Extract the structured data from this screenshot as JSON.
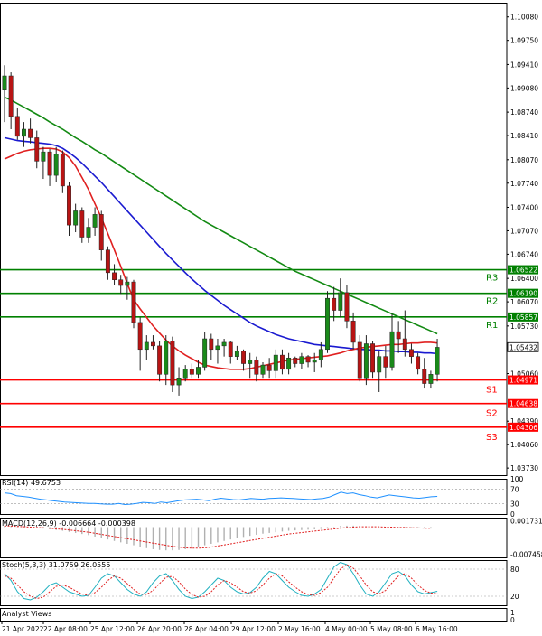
{
  "chart_data": [
    {
      "type": "candlestick",
      "panel": "main",
      "yaxis_ticks": [
        "1.10080",
        "1.09750",
        "1.09410",
        "1.09080",
        "1.08740",
        "1.08410",
        "1.08070",
        "1.07740",
        "1.07400",
        "1.07070",
        "1.06740",
        "1.06400",
        "1.06070",
        "1.05730",
        "1.05060",
        "1.04390",
        "1.04060",
        "1.03730"
      ],
      "ylim": [
        1.0363,
        1.1028
      ],
      "candles": [
        {
          "o": 1.0905,
          "h": 1.094,
          "l": 1.086,
          "c": 1.0925
        },
        {
          "o": 1.0925,
          "h": 1.093,
          "l": 1.085,
          "c": 1.0868
        },
        {
          "o": 1.0868,
          "h": 1.088,
          "l": 1.0835,
          "c": 1.084
        },
        {
          "o": 1.084,
          "h": 1.086,
          "l": 1.0825,
          "c": 1.085
        },
        {
          "o": 1.085,
          "h": 1.0865,
          "l": 1.083,
          "c": 1.0838
        },
        {
          "o": 1.0838,
          "h": 1.0848,
          "l": 1.0795,
          "c": 1.0805
        },
        {
          "o": 1.0805,
          "h": 1.0825,
          "l": 1.078,
          "c": 1.0818
        },
        {
          "o": 1.0818,
          "h": 1.0822,
          "l": 1.077,
          "c": 1.0785
        },
        {
          "o": 1.0785,
          "h": 1.0825,
          "l": 1.0775,
          "c": 1.0815
        },
        {
          "o": 1.0815,
          "h": 1.082,
          "l": 1.076,
          "c": 1.077
        },
        {
          "o": 1.077,
          "h": 1.0775,
          "l": 1.07,
          "c": 1.0715
        },
        {
          "o": 1.0715,
          "h": 1.0745,
          "l": 1.0705,
          "c": 1.0735
        },
        {
          "o": 1.0735,
          "h": 1.074,
          "l": 1.069,
          "c": 1.0698
        },
        {
          "o": 1.0698,
          "h": 1.0725,
          "l": 1.069,
          "c": 1.0712
        },
        {
          "o": 1.0712,
          "h": 1.074,
          "l": 1.07,
          "c": 1.073
        },
        {
          "o": 1.073,
          "h": 1.0735,
          "l": 1.0665,
          "c": 1.068
        },
        {
          "o": 1.068,
          "h": 1.0685,
          "l": 1.0638,
          "c": 1.0648
        },
        {
          "o": 1.0648,
          "h": 1.066,
          "l": 1.063,
          "c": 1.0638
        },
        {
          "o": 1.0638,
          "h": 1.0645,
          "l": 1.0618,
          "c": 1.063
        },
        {
          "o": 1.063,
          "h": 1.0642,
          "l": 1.061,
          "c": 1.0635
        },
        {
          "o": 1.0635,
          "h": 1.0638,
          "l": 1.057,
          "c": 1.0578
        },
        {
          "o": 1.0578,
          "h": 1.0585,
          "l": 1.051,
          "c": 1.054
        },
        {
          "o": 1.054,
          "h": 1.056,
          "l": 1.0525,
          "c": 1.055
        },
        {
          "o": 1.055,
          "h": 1.056,
          "l": 1.054,
          "c": 1.0545
        },
        {
          "o": 1.0545,
          "h": 1.0552,
          "l": 1.0495,
          "c": 1.0505
        },
        {
          "o": 1.0505,
          "h": 1.056,
          "l": 1.049,
          "c": 1.0552
        },
        {
          "o": 1.0552,
          "h": 1.0558,
          "l": 1.048,
          "c": 1.049
        },
        {
          "o": 1.049,
          "h": 1.0515,
          "l": 1.0475,
          "c": 1.05
        },
        {
          "o": 1.05,
          "h": 1.0518,
          "l": 1.0495,
          "c": 1.0512
        },
        {
          "o": 1.0512,
          "h": 1.052,
          "l": 1.05,
          "c": 1.0505
        },
        {
          "o": 1.0505,
          "h": 1.0525,
          "l": 1.05,
          "c": 1.0515
        },
        {
          "o": 1.0515,
          "h": 1.0565,
          "l": 1.051,
          "c": 1.0555
        },
        {
          "o": 1.0555,
          "h": 1.0562,
          "l": 1.0525,
          "c": 1.054
        },
        {
          "o": 1.054,
          "h": 1.0555,
          "l": 1.052,
          "c": 1.0545
        },
        {
          "o": 1.0545,
          "h": 1.0555,
          "l": 1.053,
          "c": 1.055
        },
        {
          "o": 1.055,
          "h": 1.0552,
          "l": 1.052,
          "c": 1.053
        },
        {
          "o": 1.053,
          "h": 1.0545,
          "l": 1.0525,
          "c": 1.0538
        },
        {
          "o": 1.0538,
          "h": 1.054,
          "l": 1.051,
          "c": 1.052
        },
        {
          "o": 1.052,
          "h": 1.0535,
          "l": 1.05,
          "c": 1.0525
        },
        {
          "o": 1.0525,
          "h": 1.053,
          "l": 1.0495,
          "c": 1.0505
        },
        {
          "o": 1.0505,
          "h": 1.0522,
          "l": 1.05,
          "c": 1.0518
        },
        {
          "o": 1.0518,
          "h": 1.0528,
          "l": 1.05,
          "c": 1.051
        },
        {
          "o": 1.051,
          "h": 1.054,
          "l": 1.05,
          "c": 1.0532
        },
        {
          "o": 1.0532,
          "h": 1.054,
          "l": 1.0505,
          "c": 1.0512
        },
        {
          "o": 1.0512,
          "h": 1.0535,
          "l": 1.0505,
          "c": 1.0528
        },
        {
          "o": 1.0528,
          "h": 1.053,
          "l": 1.0515,
          "c": 1.052
        },
        {
          "o": 1.052,
          "h": 1.0535,
          "l": 1.0512,
          "c": 1.053
        },
        {
          "o": 1.053,
          "h": 1.0532,
          "l": 1.0515,
          "c": 1.0522
        },
        {
          "o": 1.0522,
          "h": 1.0535,
          "l": 1.0508,
          "c": 1.0525
        },
        {
          "o": 1.0525,
          "h": 1.055,
          "l": 1.0515,
          "c": 1.054
        },
        {
          "o": 1.054,
          "h": 1.0622,
          "l": 1.0535,
          "c": 1.0612
        },
        {
          "o": 1.0612,
          "h": 1.0628,
          "l": 1.058,
          "c": 1.0595
        },
        {
          "o": 1.0595,
          "h": 1.064,
          "l": 1.0585,
          "c": 1.062
        },
        {
          "o": 1.062,
          "h": 1.063,
          "l": 1.057,
          "c": 1.058
        },
        {
          "o": 1.058,
          "h": 1.0592,
          "l": 1.054,
          "c": 1.055
        },
        {
          "o": 1.055,
          "h": 1.056,
          "l": 1.0495,
          "c": 1.05
        },
        {
          "o": 1.05,
          "h": 1.056,
          "l": 1.049,
          "c": 1.0548
        },
        {
          "o": 1.0548,
          "h": 1.0552,
          "l": 1.05,
          "c": 1.0508
        },
        {
          "o": 1.0508,
          "h": 1.0538,
          "l": 1.048,
          "c": 1.053
        },
        {
          "o": 1.053,
          "h": 1.0545,
          "l": 1.05,
          "c": 1.0515
        },
        {
          "o": 1.0515,
          "h": 1.059,
          "l": 1.051,
          "c": 1.0565
        },
        {
          "o": 1.0565,
          "h": 1.058,
          "l": 1.0535,
          "c": 1.0555
        },
        {
          "o": 1.0555,
          "h": 1.0595,
          "l": 1.053,
          "c": 1.054
        },
        {
          "o": 1.054,
          "h": 1.0548,
          "l": 1.052,
          "c": 1.053
        },
        {
          "o": 1.053,
          "h": 1.0535,
          "l": 1.0505,
          "c": 1.0512
        },
        {
          "o": 1.0512,
          "h": 1.0528,
          "l": 1.0485,
          "c": 1.0492
        },
        {
          "o": 1.0492,
          "h": 1.051,
          "l": 1.0485,
          "c": 1.0505
        },
        {
          "o": 1.0505,
          "h": 1.0555,
          "l": 1.0495,
          "c": 1.0543
        }
      ],
      "ma_blue": [
        1.0838,
        1.0836,
        1.0834,
        1.0833,
        1.0832,
        1.0831,
        1.083,
        1.0829,
        1.0827,
        1.0823,
        1.0817,
        1.081,
        1.0802,
        1.0793,
        1.0784,
        1.0775,
        1.0765,
        1.0755,
        1.0745,
        1.0735,
        1.0725,
        1.0715,
        1.0705,
        1.0695,
        1.0685,
        1.0675,
        1.0666,
        1.0657,
        1.0648,
        1.0639,
        1.0631,
        1.0623,
        1.0616,
        1.0609,
        1.0602,
        1.0596,
        1.059,
        1.0584,
        1.0578,
        1.0573,
        1.0569,
        1.0565,
        1.0561,
        1.0558,
        1.0555,
        1.0553,
        1.0551,
        1.0549,
        1.0547,
        1.0546,
        1.0545,
        1.0544,
        1.0543,
        1.0542,
        1.0541,
        1.054,
        1.054,
        1.0539,
        1.0539,
        1.0538,
        1.0538,
        1.0537,
        1.0537,
        1.0536,
        1.0536,
        1.0535,
        1.0535,
        1.0534
      ],
      "ma_red": [
        1.0808,
        1.0812,
        1.0816,
        1.0819,
        1.0821,
        1.0822,
        1.0823,
        1.0823,
        1.0822,
        1.0818,
        1.081,
        1.0798,
        1.0782,
        1.0765,
        1.0745,
        1.0725,
        1.0703,
        1.068,
        1.0657,
        1.0633,
        1.061,
        1.0597,
        1.0585,
        1.0573,
        1.0563,
        1.0553,
        1.0545,
        1.0538,
        1.0532,
        1.0527,
        1.0522,
        1.0518,
        1.0516,
        1.0514,
        1.0513,
        1.0512,
        1.0512,
        1.0512,
        1.0513,
        1.0515,
        1.0517,
        1.0519,
        1.0521,
        1.0523,
        1.0525,
        1.0526,
        1.0527,
        1.0528,
        1.0529,
        1.053,
        1.0531,
        1.0533,
        1.0535,
        1.0538,
        1.054,
        1.0542,
        1.0543,
        1.0544,
        1.0545,
        1.0546,
        1.0547,
        1.0547,
        1.0548,
        1.0549,
        1.0549,
        1.055,
        1.055,
        1.0549
      ],
      "ma_green": [
        1.0895,
        1.0891,
        1.0886,
        1.0881,
        1.0876,
        1.0871,
        1.0866,
        1.086,
        1.0855,
        1.085,
        1.0844,
        1.0838,
        1.0833,
        1.0827,
        1.0821,
        1.0816,
        1.081,
        1.0804,
        1.0798,
        1.0792,
        1.0786,
        1.078,
        1.0774,
        1.0768,
        1.0762,
        1.0756,
        1.075,
        1.0744,
        1.0738,
        1.0732,
        1.0726,
        1.072,
        1.0715,
        1.071,
        1.0705,
        1.07,
        1.0695,
        1.069,
        1.0685,
        1.068,
        1.0675,
        1.067,
        1.0665,
        1.066,
        1.0655,
        1.065,
        1.0646,
        1.0642,
        1.0638,
        1.0634,
        1.063,
        1.0626,
        1.0622,
        1.0618,
        1.0614,
        1.061,
        1.0606,
        1.0602,
        1.0598,
        1.0594,
        1.059,
        1.0586,
        1.0582,
        1.0578,
        1.0574,
        1.057,
        1.0566,
        1.0562
      ],
      "levels": [
        {
          "label": "R3",
          "value": 1.06522,
          "price_text": "1.06522",
          "color": "#008000"
        },
        {
          "label": "R2",
          "value": 1.0619,
          "price_text": "1.06190",
          "color": "#008000"
        },
        {
          "label": "R1",
          "value": 1.05857,
          "price_text": "1.05857",
          "color": "#008000"
        },
        {
          "label": "S1",
          "value": 1.04971,
          "price_text": "1.04971",
          "color": "#ff0000"
        },
        {
          "label": "S2",
          "value": 1.04638,
          "price_text": "1.04638",
          "color": "#ff0000"
        },
        {
          "label": "S3",
          "value": 1.04306,
          "price_text": "1.04306",
          "color": "#ff0000"
        }
      ],
      "current_price": {
        "value": 1.05432,
        "text": "1.05432"
      },
      "xaxis_ticks": [
        "21 Apr 2022",
        "22 Apr 08:00",
        "25 Apr 12:00",
        "26 Apr 20:00",
        "28 Apr 04:00",
        "29 Apr 12:00",
        "2 May 16:00",
        "4 May 00:00",
        "5 May 08:00",
        "6 May 16:00"
      ]
    },
    {
      "type": "line",
      "panel": "rsi",
      "label": "RSI(14) 49.6753",
      "yaxis_ticks": [
        "100",
        "70",
        "30",
        "0"
      ],
      "ylim": [
        0,
        100
      ],
      "values": [
        60,
        58,
        52,
        50,
        48,
        45,
        42,
        40,
        38,
        36,
        34,
        33,
        32,
        31,
        30,
        30,
        29,
        28,
        28,
        30,
        27,
        28,
        30,
        33,
        32,
        30,
        34,
        32,
        35,
        38,
        40,
        41,
        42,
        40,
        38,
        42,
        45,
        43,
        41,
        40,
        42,
        44,
        43,
        42,
        44,
        45,
        46,
        45,
        44,
        43,
        42,
        41,
        43,
        44,
        48,
        55,
        62,
        58,
        60,
        55,
        52,
        48,
        46,
        50,
        54,
        52,
        50,
        48,
        46,
        45,
        47,
        49,
        50
      ]
    },
    {
      "type": "line",
      "panel": "macd",
      "label": "MACD(12,26,9) -0.006664 -0.000398",
      "yaxis_ticks": [
        "0.001731",
        "-0.007458"
      ],
      "ylim": [
        -0.00835,
        0.00262
      ],
      "histogram": [
        0.0004,
        0.0003,
        0.0002,
        0.0001,
        0.0,
        -0.0002,
        -0.0004,
        -0.0006,
        -0.0008,
        -0.001,
        -0.0013,
        -0.0016,
        -0.0019,
        -0.0022,
        -0.0026,
        -0.003,
        -0.0034,
        -0.0038,
        -0.0042,
        -0.0046,
        -0.005,
        -0.0054,
        -0.0058,
        -0.0061,
        -0.0063,
        -0.0064,
        -0.0064,
        -0.0063,
        -0.0061,
        -0.0058,
        -0.0054,
        -0.005,
        -0.0046,
        -0.0042,
        -0.0038,
        -0.0034,
        -0.003,
        -0.0027,
        -0.0024,
        -0.0021,
        -0.0018,
        -0.0016,
        -0.0014,
        -0.0012,
        -0.001,
        -0.0009,
        -0.0008,
        -0.0007,
        -0.0006,
        -0.0005,
        -0.0002,
        0.0001,
        0.0003,
        0.0004,
        0.0004,
        0.0003,
        0.0002,
        0.0002,
        0.0001,
        0.0,
        0.0,
        -0.0001,
        -0.0001,
        -0.0002,
        -0.0003,
        -0.0004,
        -0.0004
      ],
      "signal": [
        0.0003,
        0.0003,
        0.0002,
        0.0001,
        0.0,
        -0.0001,
        -0.0002,
        -0.0003,
        -0.0005,
        -0.0006,
        -0.0008,
        -0.001,
        -0.0012,
        -0.0014,
        -0.0017,
        -0.002,
        -0.0023,
        -0.0026,
        -0.0029,
        -0.0032,
        -0.0035,
        -0.0038,
        -0.0041,
        -0.0044,
        -0.0047,
        -0.005,
        -0.0053,
        -0.0055,
        -0.0057,
        -0.0058,
        -0.0058,
        -0.0057,
        -0.0055,
        -0.0052,
        -0.0049,
        -0.0046,
        -0.0043,
        -0.004,
        -0.0037,
        -0.0034,
        -0.0031,
        -0.0028,
        -0.0025,
        -0.0022,
        -0.0019,
        -0.0017,
        -0.0015,
        -0.0013,
        -0.0011,
        -0.0009,
        -0.0007,
        -0.0005,
        -0.0003,
        -0.0001,
        0.0,
        0.0001,
        0.0001,
        0.0001,
        0.0001,
        0.0,
        0.0,
        -0.0001,
        -0.0001,
        -0.0002,
        -0.0002,
        -0.0003,
        -0.0003
      ]
    },
    {
      "type": "line",
      "panel": "stoch",
      "label": "Stoch(5,3,3) 31.0759 26.0555",
      "yaxis_ticks": [
        "80",
        "20"
      ],
      "ylim": [
        0,
        100
      ],
      "main": [
        70,
        55,
        30,
        15,
        12,
        18,
        30,
        45,
        50,
        40,
        30,
        25,
        20,
        22,
        40,
        60,
        70,
        65,
        50,
        35,
        25,
        20,
        30,
        50,
        65,
        70,
        55,
        35,
        20,
        15,
        18,
        30,
        45,
        60,
        55,
        40,
        30,
        25,
        28,
        40,
        60,
        75,
        70,
        55,
        40,
        30,
        22,
        20,
        25,
        35,
        60,
        85,
        95,
        90,
        70,
        45,
        25,
        20,
        30,
        50,
        70,
        75,
        65,
        45,
        30,
        25,
        28,
        31
      ],
      "signal": [
        65,
        60,
        45,
        30,
        20,
        15,
        18,
        30,
        42,
        45,
        40,
        32,
        25,
        22,
        28,
        40,
        55,
        65,
        60,
        48,
        35,
        25,
        24,
        33,
        48,
        62,
        64,
        52,
        36,
        24,
        18,
        20,
        30,
        45,
        55,
        50,
        40,
        30,
        27,
        32,
        45,
        60,
        70,
        65,
        52,
        40,
        30,
        24,
        22,
        28,
        40,
        60,
        80,
        90,
        82,
        65,
        45,
        30,
        25,
        33,
        50,
        65,
        70,
        60,
        45,
        33,
        27,
        26
      ]
    }
  ],
  "footer": {
    "analyst": "Analyst Views"
  }
}
